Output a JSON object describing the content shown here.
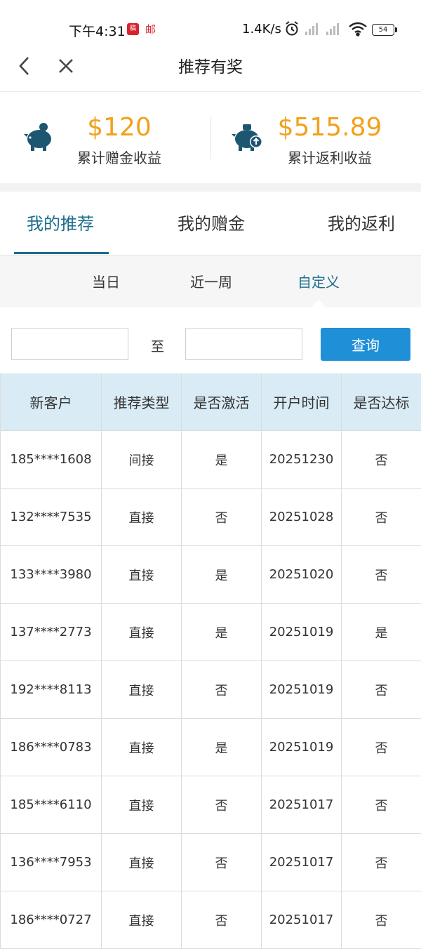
{
  "status_bar": {
    "time": "下午4:31",
    "app_icon_1": "稿",
    "app_icon_2": "邮",
    "net_speed": "1.4K/s",
    "battery": "54",
    "icons": [
      "alarm-icon",
      "signal-icon",
      "signal-icon",
      "wifi-icon",
      "battery-icon"
    ]
  },
  "header": {
    "title": "推荐有奖",
    "back_icon": "chevron-left-icon",
    "close_icon": "close-icon"
  },
  "summary": {
    "bonus": {
      "amount": "$120",
      "label": "累计赠金收益",
      "icon": "piggy-bank-icon"
    },
    "rebate": {
      "amount": "$515.89",
      "label": "累计返利收益",
      "icon": "piggy-bank-up-icon"
    }
  },
  "tabs": [
    {
      "label": "我的推荐",
      "active": true
    },
    {
      "label": "我的赠金",
      "active": false
    },
    {
      "label": "我的返利",
      "active": false
    }
  ],
  "filters": [
    {
      "label": "当日",
      "active": false
    },
    {
      "label": "近一周",
      "active": false
    },
    {
      "label": "自定义",
      "active": true
    }
  ],
  "date_range": {
    "start_value": "",
    "end_value": "",
    "separator": "至",
    "query_label": "查询"
  },
  "table": {
    "headers": [
      "新客户",
      "推荐类型",
      "是否激活",
      "开户时间",
      "是否达标"
    ],
    "rows": [
      [
        "185****1608",
        "间接",
        "是",
        "20251230",
        "否"
      ],
      [
        "132****7535",
        "直接",
        "否",
        "20251028",
        "否"
      ],
      [
        "133****3980",
        "直接",
        "是",
        "20251020",
        "否"
      ],
      [
        "137****2773",
        "直接",
        "是",
        "20251019",
        "是"
      ],
      [
        "192****8113",
        "直接",
        "否",
        "20251019",
        "否"
      ],
      [
        "186****0783",
        "直接",
        "是",
        "20251019",
        "否"
      ],
      [
        "185****6110",
        "直接",
        "否",
        "20251017",
        "否"
      ],
      [
        "136****7953",
        "直接",
        "否",
        "20251017",
        "否"
      ],
      [
        "186****0727",
        "直接",
        "否",
        "20251017",
        "否"
      ]
    ]
  },
  "colors": {
    "accent": "#1d6d8d",
    "amount": "#f2a11c",
    "button": "#1f8fd8",
    "table_header_bg": "#d9ebf4"
  }
}
